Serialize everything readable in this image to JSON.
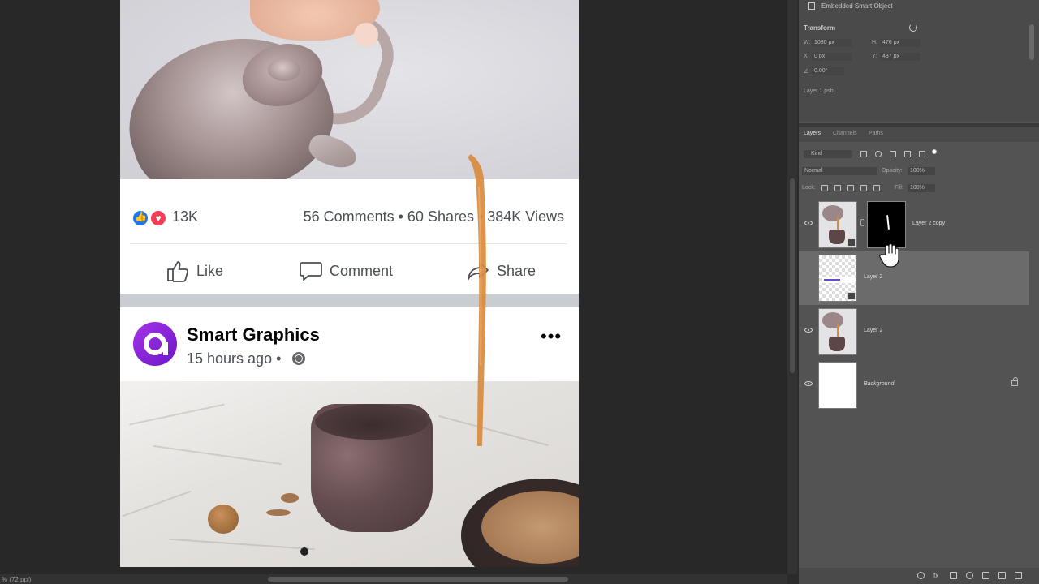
{
  "post": {
    "reaction_count": "13K",
    "stats": "56 Comments • 60 Shares • 384K Views",
    "actions": {
      "like": "Like",
      "comment": "Comment",
      "share": "Share"
    },
    "author": "Smart Graphics",
    "time": "15 hours ago •"
  },
  "status": {
    "zoom": "% (72 ppi)"
  },
  "properties": {
    "header": "Embedded Smart Object",
    "section": "Transform",
    "w_label": "W:",
    "w_value": "1080 px",
    "h_label": "H:",
    "h_value": "476 px",
    "x_label": "X:",
    "x_value": "0 px",
    "y_label": "Y:",
    "y_value": "437 px",
    "angle_value": "0.00°",
    "footer": "Layer 1.psb"
  },
  "layers_panel": {
    "tabs": [
      "Layers",
      "Channels",
      "Paths"
    ],
    "filter": "Kind",
    "blend_mode": "Normal",
    "opacity_label": "Opacity:",
    "opacity_value": "100%",
    "lock_label": "Lock:",
    "fill_label": "Fill:",
    "fill_value": "100%",
    "layers": [
      {
        "name": "Layer 2 copy"
      },
      {
        "name": "Layer 2"
      },
      {
        "name": "Layer 2"
      },
      {
        "name": "Background"
      }
    ]
  },
  "icons": [
    "like-reaction-icon",
    "love-reaction-icon",
    "thumbs-up-icon",
    "comment-icon",
    "share-icon",
    "globe-icon",
    "more-icon",
    "eye-icon",
    "lock-icon",
    "hand-cursor"
  ],
  "colors": {
    "facebook_blue": "#1877f2",
    "love_red": "#f33e58",
    "brand_purple": "#8a2be2",
    "tea": "#d98b3d"
  }
}
